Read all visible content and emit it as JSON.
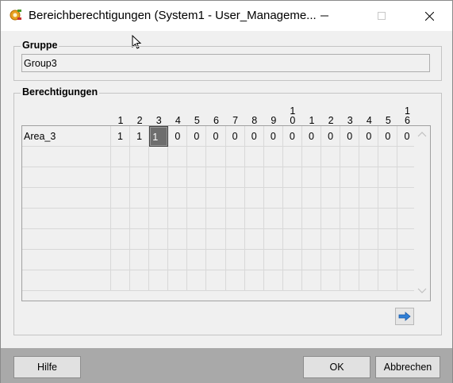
{
  "window": {
    "title": "Bereichberechtigungen (System1 - User_Manageme...",
    "app_icon": "gear-key-icon"
  },
  "gruppe": {
    "label": "Gruppe",
    "value": "Group3"
  },
  "berechtigungen": {
    "label": "Berechtigungen",
    "columns": [
      {
        "top": "",
        "bottom": "1"
      },
      {
        "top": "",
        "bottom": "2"
      },
      {
        "top": "",
        "bottom": "3"
      },
      {
        "top": "",
        "bottom": "4"
      },
      {
        "top": "",
        "bottom": "5"
      },
      {
        "top": "",
        "bottom": "6"
      },
      {
        "top": "",
        "bottom": "7"
      },
      {
        "top": "",
        "bottom": "8"
      },
      {
        "top": "",
        "bottom": "9"
      },
      {
        "top": "1",
        "bottom": "0"
      },
      {
        "top": "",
        "bottom": "1"
      },
      {
        "top": "",
        "bottom": "2"
      },
      {
        "top": "",
        "bottom": "3"
      },
      {
        "top": "",
        "bottom": "4"
      },
      {
        "top": "",
        "bottom": "5"
      },
      {
        "top": "1",
        "bottom": "6"
      }
    ],
    "rows": [
      {
        "name": "Area_3",
        "values": [
          "1",
          "1",
          "1",
          "0",
          "0",
          "0",
          "0",
          "0",
          "0",
          "0",
          "0",
          "0",
          "0",
          "0",
          "0",
          "0"
        ],
        "active_index": 2
      }
    ],
    "empty_rows": 7,
    "next_icon": "arrow-right-icon"
  },
  "buttons": {
    "hilfe": "Hilfe",
    "ok": "OK",
    "abbrechen": "Abbrechen"
  },
  "colors": {
    "accent_arrow": "#2f7fd6",
    "bottom_bar": "#a9a9a9"
  }
}
